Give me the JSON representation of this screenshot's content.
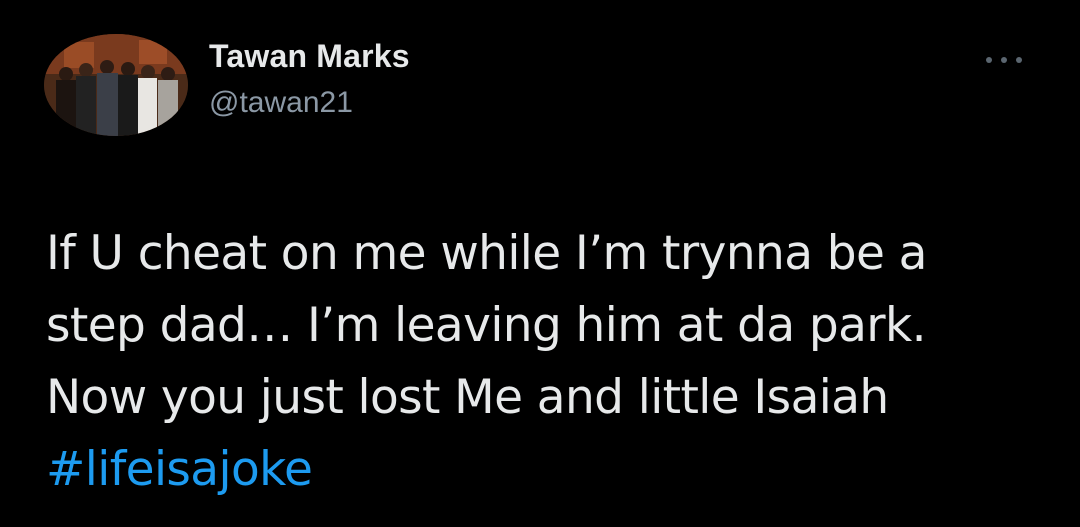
{
  "author": {
    "display_name": "Tawan Marks",
    "handle": "@tawan21",
    "avatar_icon": "group-photo-avatar"
  },
  "menu": {
    "more_icon": "more-options-icon"
  },
  "tweet": {
    "lines": [
      "If U cheat on me while I’m trynna be a",
      "step dad… I’m leaving him at da park.",
      "Now you just lost Me and little Isaiah"
    ],
    "hashtag": "#lifeisajoke"
  },
  "colors": {
    "background": "#000000",
    "text": "#e7e9ea",
    "secondary": "#8b98a5",
    "link": "#1d9bf0"
  }
}
